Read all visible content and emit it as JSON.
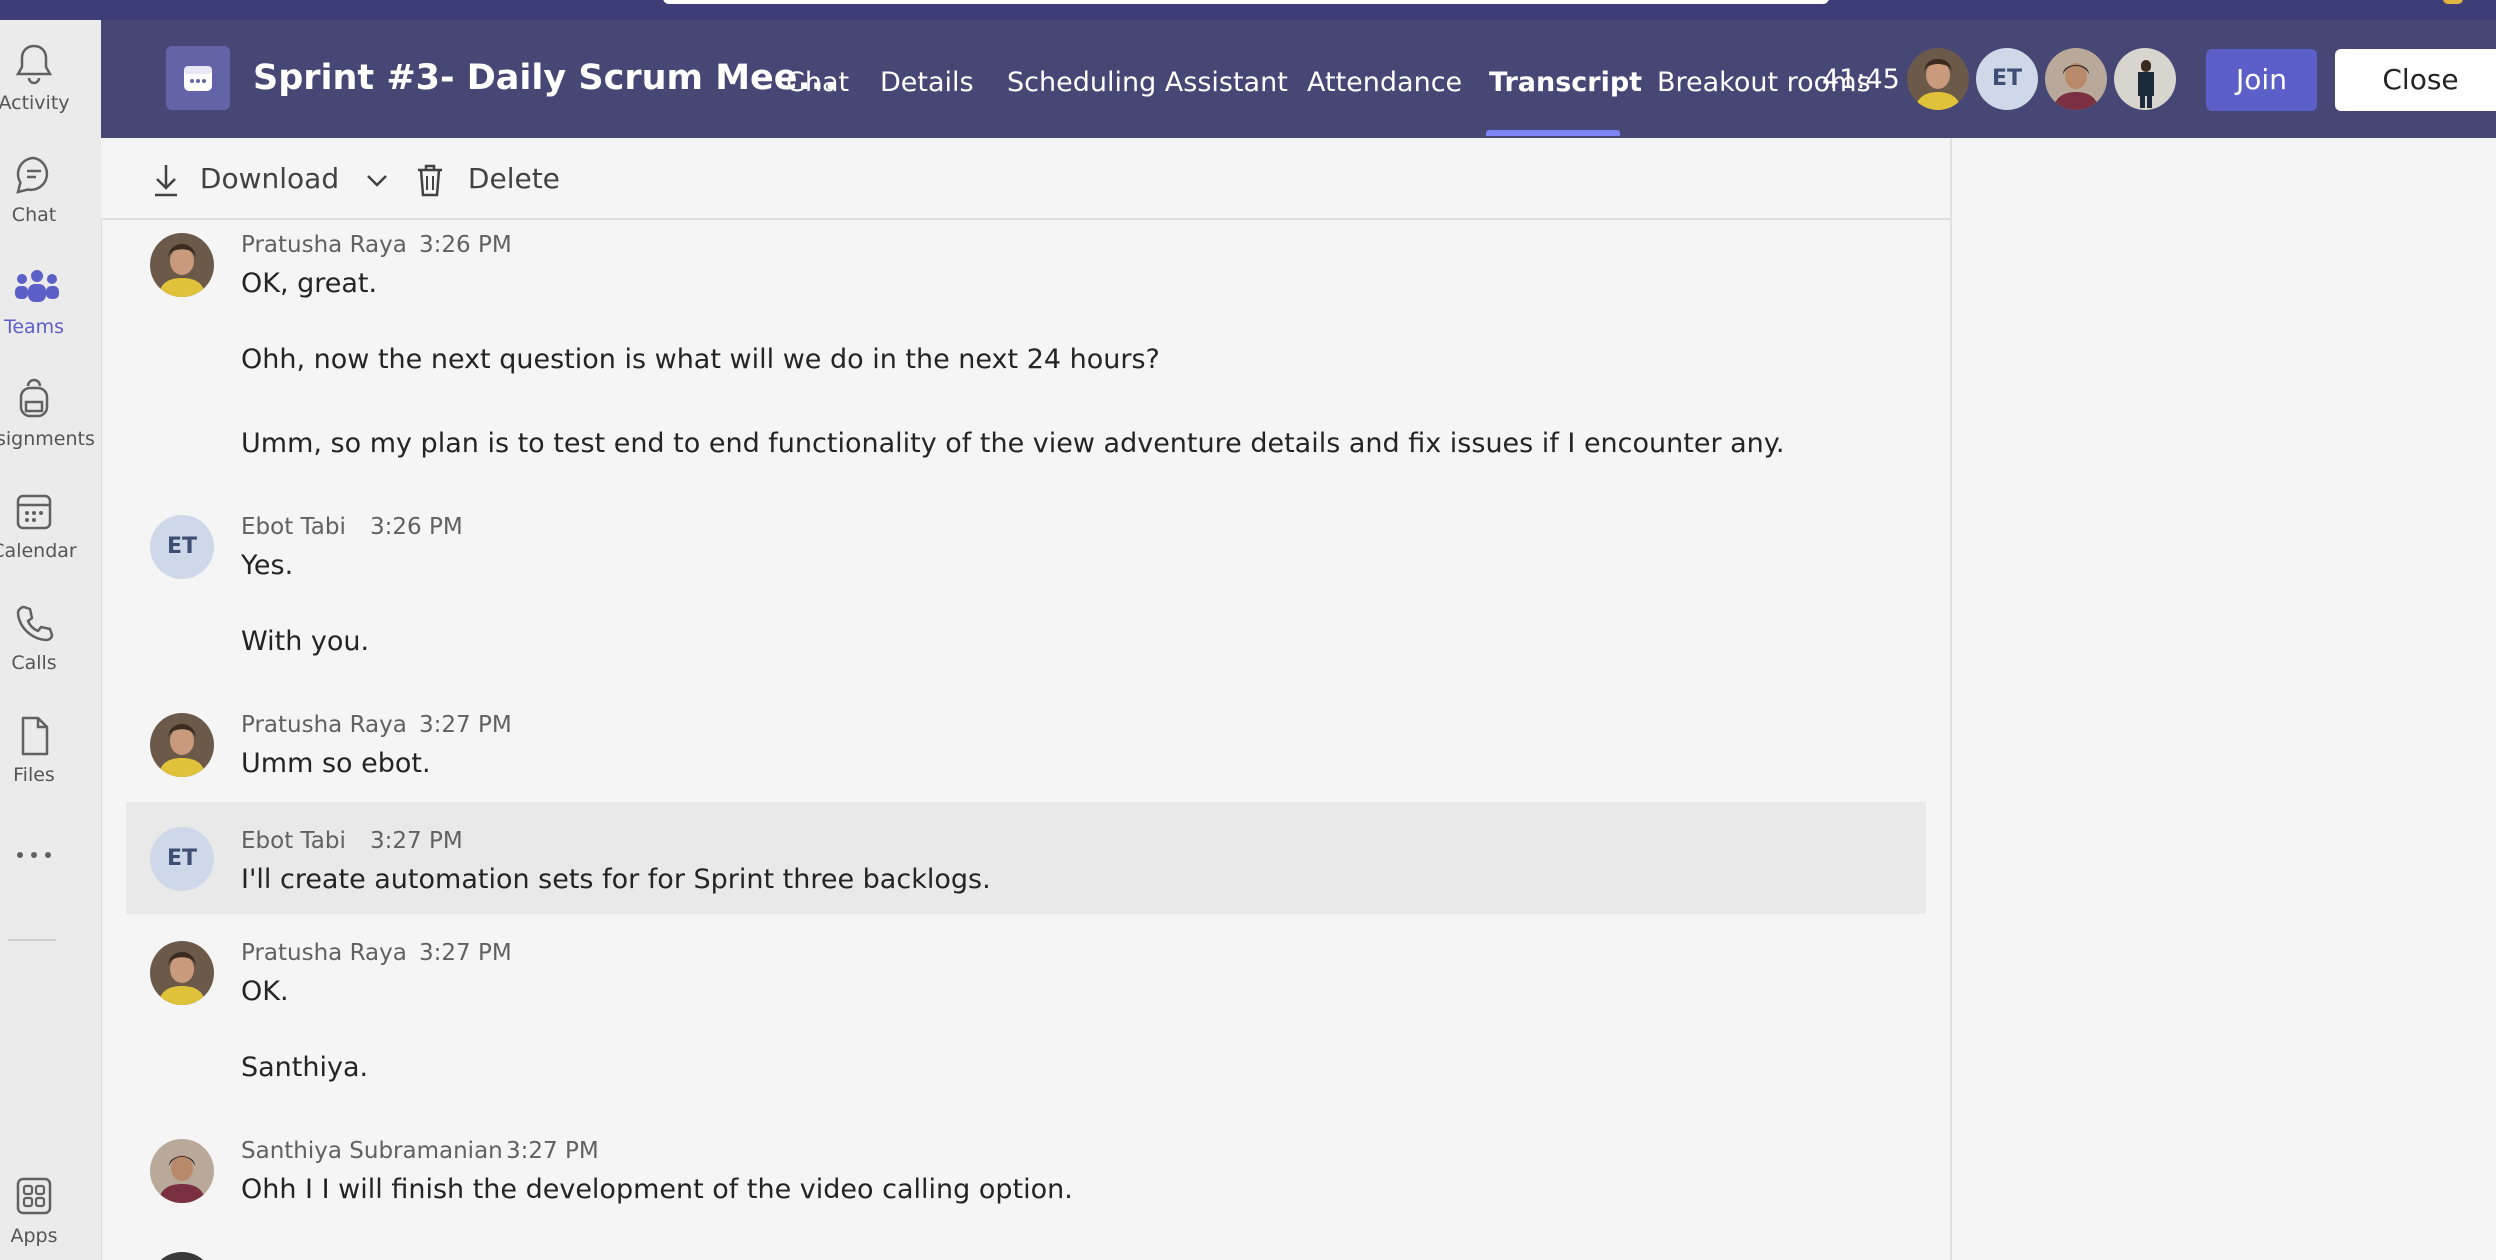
{
  "sidebar": {
    "items": [
      {
        "label": "Activity",
        "icon": "bell-icon"
      },
      {
        "label": "Chat",
        "icon": "chat-icon"
      },
      {
        "label": "Teams",
        "icon": "teams-icon"
      },
      {
        "label": "Assignments",
        "icon": "backpack-icon"
      },
      {
        "label": "Calendar",
        "icon": "calendar-icon"
      },
      {
        "label": "Calls",
        "icon": "phone-icon"
      },
      {
        "label": "Files",
        "icon": "file-icon"
      },
      {
        "label": "Apps",
        "icon": "apps-icon"
      }
    ],
    "more_icon": "more-icon",
    "active": "Teams",
    "accent_color": "#5b5fc7"
  },
  "header": {
    "title": "Sprint #3- Daily Scrum Mee...",
    "tabs": [
      {
        "label": "Chat"
      },
      {
        "label": "Details"
      },
      {
        "label": "Scheduling Assistant"
      },
      {
        "label": "Attendance"
      },
      {
        "label": "Transcript"
      },
      {
        "label": "Breakout rooms"
      }
    ],
    "active_tab": "Transcript",
    "timer": "41:45",
    "participant_initials": "ET",
    "join_label": "Join",
    "close_label": "Close",
    "background_color": "#464775"
  },
  "toolbar": {
    "download_label": "Download",
    "delete_label": "Delete"
  },
  "transcript": {
    "entries": [
      {
        "name": "Pratusha Raya",
        "time": "3:26 PM",
        "lines": [
          "OK, great.",
          "Ohh, now the next question is what will we do in the next 24 hours?",
          "Umm, so my plan is to test end to end functionality of the view adventure details and fix issues if I encounter any."
        ]
      },
      {
        "name": "Ebot Tabi",
        "initials": "ET",
        "time": "3:26 PM",
        "lines": [
          "Yes.",
          "With you."
        ]
      },
      {
        "name": "Pratusha Raya",
        "time": "3:27 PM",
        "lines": [
          "Umm so ebot."
        ]
      },
      {
        "name": "Ebot Tabi",
        "initials": "ET",
        "time": "3:27 PM",
        "lines": [
          "I'll create automation sets for for Sprint three backlogs."
        ]
      },
      {
        "name": "Pratusha Raya",
        "time": "3:27 PM",
        "lines": [
          "OK.",
          "Santhiya."
        ]
      },
      {
        "name": "Santhiya Subramanian",
        "time": "3:27 PM",
        "lines": [
          "Ohh I I will finish the development of the video calling option."
        ]
      }
    ]
  }
}
